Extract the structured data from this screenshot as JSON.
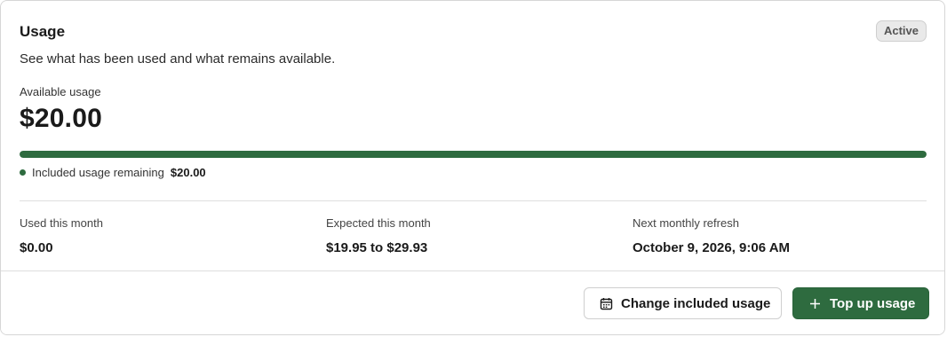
{
  "usage": {
    "title": "Usage",
    "status_badge": "Active",
    "subtitle": "See what has been used and what remains available.",
    "available_label": "Available usage",
    "available_amount": "$20.00",
    "progress_fraction": 1.0,
    "legend_label": "Included usage remaining",
    "legend_value": "$20.00",
    "accent_color": "#2e6b3f"
  },
  "stats": [
    {
      "label": "Used this month",
      "value": "$0.00"
    },
    {
      "label": "Expected this month",
      "value": "$19.95 to $29.93"
    },
    {
      "label": "Next monthly refresh",
      "value": "October 9, 2026, 9:06 AM"
    }
  ],
  "actions": {
    "change_label": "Change included usage",
    "change_icon": "calendar-icon",
    "topup_label": "Top up usage",
    "topup_icon": "plus-icon"
  }
}
